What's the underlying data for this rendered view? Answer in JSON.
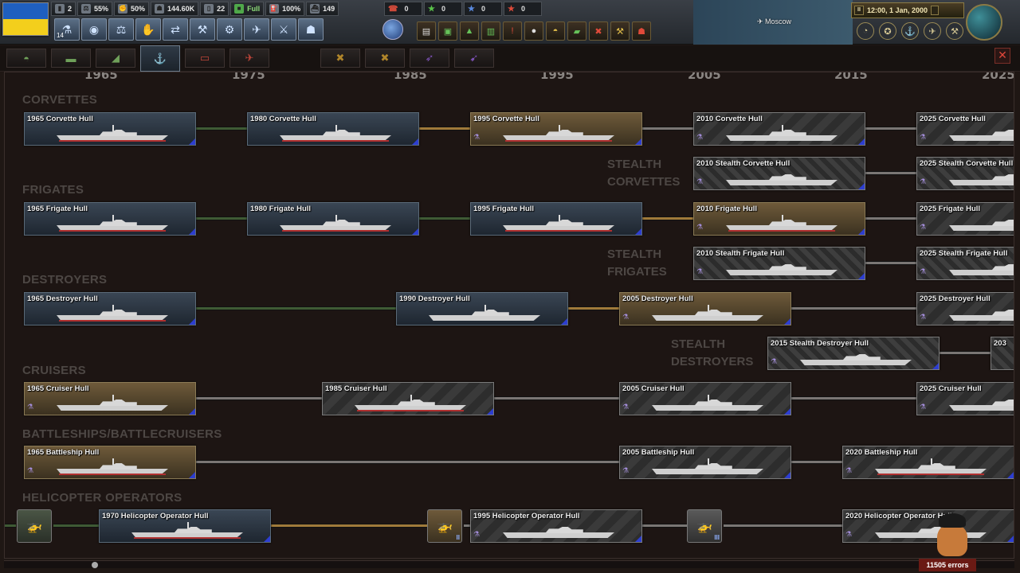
{
  "topbar": {
    "resources": [
      {
        "icon": "factory-icon",
        "value": "2"
      },
      {
        "icon": "stability-icon",
        "value": "55%"
      },
      {
        "icon": "war-support-icon",
        "value": "50%"
      },
      {
        "icon": "manpower-icon",
        "value": "144.60K"
      },
      {
        "icon": "civilian-factory-icon",
        "value": "22"
      },
      {
        "icon": "supply-icon",
        "value": "Full"
      },
      {
        "icon": "fuel-icon",
        "value": "100%"
      },
      {
        "icon": "convoy-icon",
        "value": "149"
      }
    ],
    "alerts": [
      "0",
      "0",
      "0",
      "0"
    ],
    "research_slots": "14",
    "date": "12:00, 1 Jan, 2000",
    "city": "Moscow"
  },
  "tabs": [
    {
      "icon": "infantry-helmet-icon",
      "color": "green"
    },
    {
      "icon": "tank-icon",
      "color": "green"
    },
    {
      "icon": "artillery-icon",
      "color": "green"
    },
    {
      "icon": "anchor-icon",
      "color": "blue"
    },
    {
      "icon": "helicopter-icon",
      "color": "red"
    },
    {
      "icon": "jet-icon",
      "color": "red"
    },
    {
      "icon": "crossed-hammers-icon",
      "color": "gold"
    },
    {
      "icon": "crossed-tools-icon",
      "color": "gold"
    },
    {
      "icon": "missile-icon",
      "color": "purple"
    },
    {
      "icon": "rocket-icon",
      "color": "purple"
    }
  ],
  "years": [
    "1965",
    "1975",
    "1985",
    "1995",
    "2005",
    "2015",
    "2025"
  ],
  "sections": {
    "corvettes": "CORVETTES",
    "stealth_corvettes": "STEALTH CORVETTES",
    "frigates": "FRIGATES",
    "stealth_frigates": "STEALTH FRIGATES",
    "destroyers": "DESTROYERS",
    "stealth_destroyers": "STEALTH DESTROYERS",
    "cruisers": "CRUISERS",
    "battleships": "BATTLESHIPS/BATTLECRUISERS",
    "helicopter_operators": "HELICOPTER OPERATORS"
  },
  "techs": {
    "corvette_1965": "1965 Corvette Hull",
    "corvette_1980": "1980 Corvette Hull",
    "corvette_1995": "1995 Corvette Hull",
    "corvette_2010": "2010 Corvette Hull",
    "corvette_2025": "2025 Corvette Hull",
    "stealth_corvette_2010": "2010 Stealth Corvette Hull",
    "stealth_corvette_2025": "2025 Stealth Corvette Hull",
    "frigate_1965": "1965 Frigate Hull",
    "frigate_1980": "1980 Frigate Hull",
    "frigate_1995": "1995 Frigate Hull",
    "frigate_2010": "2010 Frigate Hull",
    "frigate_2025": "2025 Frigate Hull",
    "stealth_frigate_2010": "2010 Stealth Frigate Hull",
    "stealth_frigate_2025": "2025 Stealth Frigate Hull",
    "destroyer_1965": "1965 Destroyer Hull",
    "destroyer_1990": "1990 Destroyer Hull",
    "destroyer_2005": "2005 Destroyer Hull",
    "destroyer_2025": "2025 Destroyer Hull",
    "stealth_destroyer_2015": "2015 Stealth Destroyer Hull",
    "stealth_destroyer_2030": "203",
    "cruiser_1965": "1965 Cruiser Hull",
    "cruiser_1985": "1985 Cruiser Hull",
    "cruiser_2005": "2005 Cruiser Hull",
    "cruiser_2025": "2025 Cruiser Hull",
    "battleship_1965": "1965 Battleship Hull",
    "battleship_2005": "2005 Battleship Hull",
    "battleship_2020": "2020 Battleship Hull",
    "heli_1970": "1970 Helicopter Operator Hull",
    "heli_1995": "1995 Helicopter Operator Hull",
    "heli_2020": "2020 Helicopter Operator Hull"
  },
  "mini_tiers": [
    "II",
    "III"
  ],
  "errors": "11505 errors",
  "colors": {
    "researched": "#3f5a34",
    "in_progress": "#a07a3a",
    "locked": "#7a7674",
    "flag_blue": "#1f5fbf",
    "flag_yellow": "#f3cf1c"
  }
}
